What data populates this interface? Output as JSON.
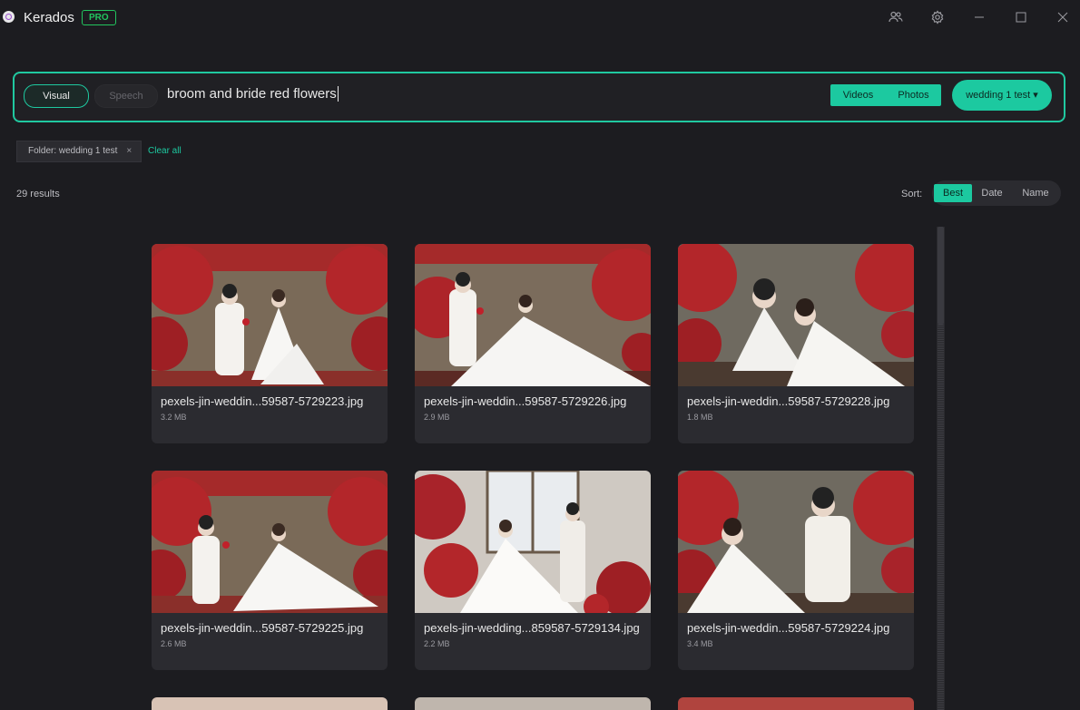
{
  "app": {
    "title": "Kerados",
    "badge": "PRO"
  },
  "window_controls": [
    "people-icon",
    "settings-gear-icon",
    "minimize-icon",
    "maximize-icon",
    "close-icon"
  ],
  "search": {
    "mode_visual": "Visual",
    "mode_speech": "Speech",
    "query": "broom and bride red flowers",
    "media_videos": "Videos",
    "media_photos": "Photos",
    "folder": "wedding 1 test ▾"
  },
  "filters": {
    "chip": "Folder: wedding 1 test",
    "chip_remove": "×",
    "clear_all": "Clear all"
  },
  "results": {
    "count": "29 results"
  },
  "sort": {
    "label": "Sort:",
    "options": [
      "Best",
      "Date",
      "Name"
    ],
    "selected": "Best"
  },
  "accent_color": "#1cc9a0",
  "items": [
    {
      "name": "pexels-jin-weddin...59587-5729223.jpg",
      "size": "3.2 MB"
    },
    {
      "name": "pexels-jin-weddin...59587-5729226.jpg",
      "size": "2.9 MB"
    },
    {
      "name": "pexels-jin-weddin...59587-5729228.jpg",
      "size": "1.8 MB"
    },
    {
      "name": "pexels-jin-weddin...59587-5729225.jpg",
      "size": "2.6 MB"
    },
    {
      "name": "pexels-jin-wedding...859587-5729134.jpg",
      "size": "2.2 MB"
    },
    {
      "name": "pexels-jin-weddin...59587-5729224.jpg",
      "size": "3.4 MB"
    }
  ]
}
